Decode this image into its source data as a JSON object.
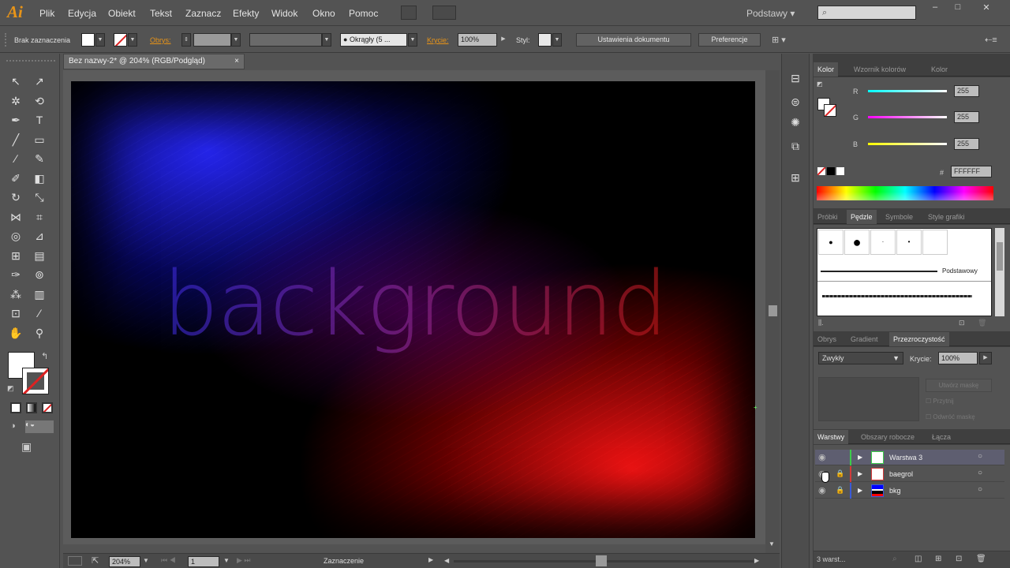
{
  "app": {
    "logo": "Ai"
  },
  "menu": [
    "Plik",
    "Edycja",
    "Obiekt",
    "Tekst",
    "Zaznacz",
    "Efekty",
    "Widok",
    "Okno",
    "Pomoc"
  ],
  "workspace": "Podstawy",
  "window_controls": [
    "–",
    "□",
    "✕"
  ],
  "control": {
    "selection": "Brak zaznaczenia",
    "stroke_label": "Obrys:",
    "brush_value": "Okrągły (5 ...",
    "opacity_label": "Krycie:",
    "opacity_value": "100%",
    "style_label": "Styl:",
    "doc_settings": "Ustawienia dokumentu",
    "prefs": "Preferencje"
  },
  "document": {
    "tab_title": "Bez nazwy-2* @ 204% (RGB/Podgląd)",
    "canvas_text": "background"
  },
  "status": {
    "zoom": "204%",
    "artboard": "1",
    "mode": "Zaznaczenie"
  },
  "color_panel": {
    "tabs": [
      "Kolor",
      "Wzornik kolorów",
      "Kolor"
    ],
    "channels": [
      {
        "label": "R",
        "value": "255"
      },
      {
        "label": "G",
        "value": "255"
      },
      {
        "label": "B",
        "value": "255"
      }
    ],
    "hex_label": "#",
    "hex": "FFFFFF"
  },
  "brush_panel": {
    "tabs": [
      "Próbki",
      "Pędzle",
      "Symbole",
      "Style grafiki"
    ],
    "basic_label": "Podstawowy"
  },
  "transparency_panel": {
    "tabs": [
      "Obrys",
      "Gradient",
      "Przezroczystość"
    ],
    "blend": "Zwykły",
    "opacity_label": "Krycie:",
    "opacity_value": "100%",
    "make_mask": "Utwórz maskę",
    "clip": "Przytnij",
    "invert": "Odwróć maskę"
  },
  "layers_panel": {
    "tabs": [
      "Warstwy",
      "Obszary robocze",
      "Łącza"
    ],
    "layers": [
      {
        "name": "Warstwa 3"
      },
      {
        "name": "baegrol"
      },
      {
        "name": "bkg"
      }
    ],
    "footer": "3 warst..."
  },
  "colors": {
    "bg_dark": "#535353",
    "accent_orange": "#e89418",
    "layer_green": "#3ccc4a",
    "layer_red": "#d23a3a",
    "layer_blue": "#3a5ad8"
  }
}
